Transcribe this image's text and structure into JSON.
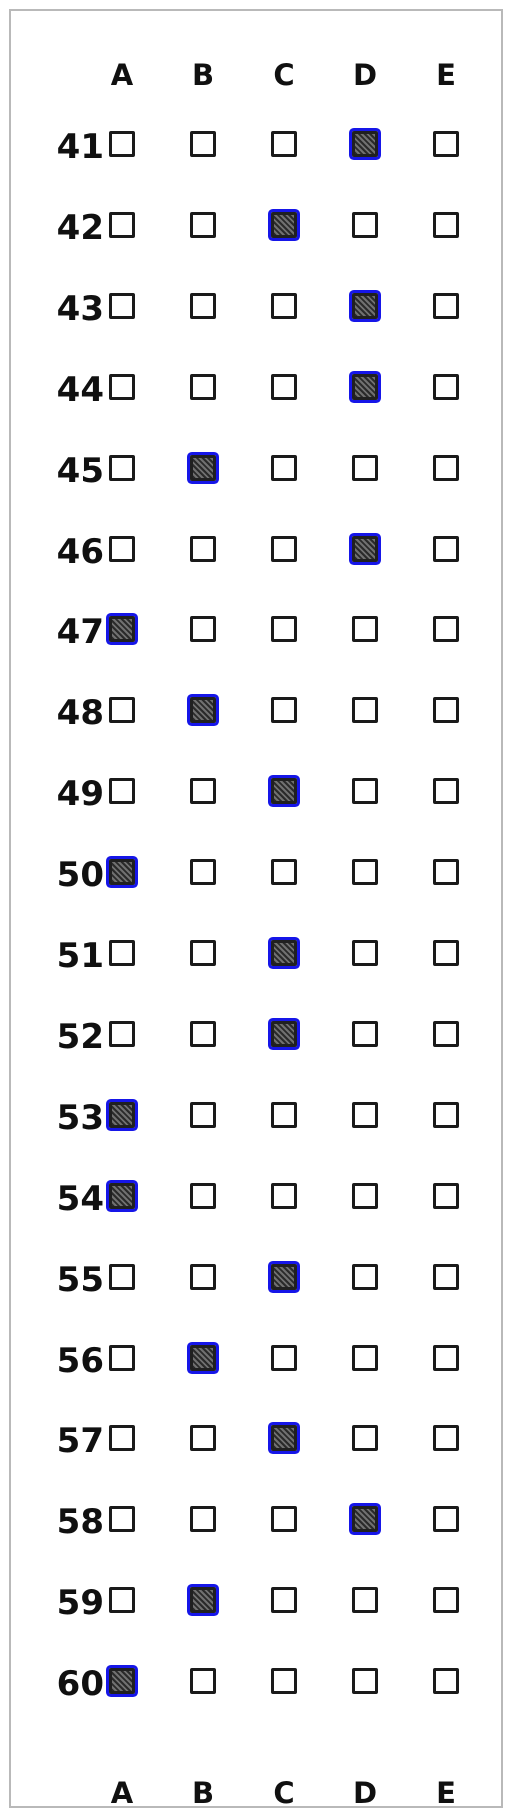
{
  "columns": [
    "A",
    "B",
    "C",
    "D",
    "E"
  ],
  "questions": [
    {
      "number": "41",
      "marked": "D"
    },
    {
      "number": "42",
      "marked": "C"
    },
    {
      "number": "43",
      "marked": "D"
    },
    {
      "number": "44",
      "marked": "D"
    },
    {
      "number": "45",
      "marked": "B"
    },
    {
      "number": "46",
      "marked": "D"
    },
    {
      "number": "47",
      "marked": "A"
    },
    {
      "number": "48",
      "marked": "B"
    },
    {
      "number": "49",
      "marked": "C"
    },
    {
      "number": "50",
      "marked": "A"
    },
    {
      "number": "51",
      "marked": "C"
    },
    {
      "number": "52",
      "marked": "C"
    },
    {
      "number": "53",
      "marked": "A"
    },
    {
      "number": "54",
      "marked": "A"
    },
    {
      "number": "55",
      "marked": "C"
    },
    {
      "number": "56",
      "marked": "B"
    },
    {
      "number": "57",
      "marked": "C"
    },
    {
      "number": "58",
      "marked": "D"
    },
    {
      "number": "59",
      "marked": "B"
    },
    {
      "number": "60",
      "marked": "A"
    }
  ],
  "colors": {
    "mark_outline": "#1616e8",
    "box_border": "#1a1a1a"
  }
}
